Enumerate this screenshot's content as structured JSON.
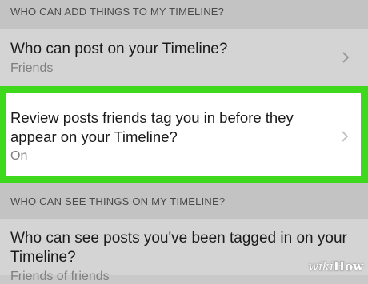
{
  "sections": {
    "add_header": "WHO CAN ADD THINGS TO MY TIMELINE?",
    "see_header": "WHO CAN SEE THINGS ON MY TIMELINE?"
  },
  "rows": [
    {
      "title": "Who can post on your Timeline?",
      "value": "Friends"
    },
    {
      "title": "Review posts friends tag you in before they appear on your Timeline?",
      "value": "On"
    },
    {
      "title": "Who can see posts you've been tagged in on your Timeline?",
      "value": "Friends of friends"
    }
  ],
  "watermark": {
    "wiki": "wiki",
    "how": "How"
  },
  "colors": {
    "highlight": "#3ed81c",
    "background": "#c9c9c9",
    "selected_row": "#ffffff"
  },
  "icons": {
    "row_chevron": "chevron-right-icon"
  }
}
